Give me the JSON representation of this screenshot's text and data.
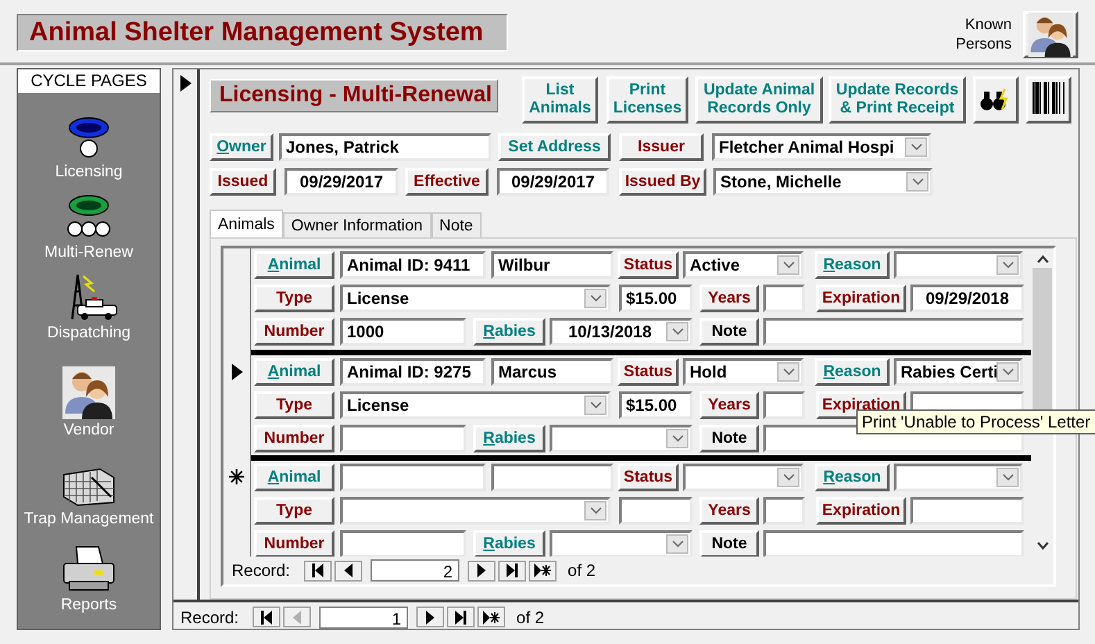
{
  "app_title": "Animal Shelter Management System",
  "known_persons": {
    "label": "Known Persons"
  },
  "sidebar": {
    "header": "CYCLE PAGES",
    "items": [
      {
        "label": "Licensing"
      },
      {
        "label": "Multi-Renew"
      },
      {
        "label": "Dispatching"
      },
      {
        "label": "Vendor"
      },
      {
        "label": "Trap Management"
      },
      {
        "label": "Reports"
      }
    ]
  },
  "form": {
    "title": "Licensing - Multi-Renewal",
    "actions": [
      {
        "text": "List\nAnimals"
      },
      {
        "text": "Print\nLicenses"
      },
      {
        "text": "Update Animal\nRecords Only"
      },
      {
        "text": "Update Records\n& Print Receipt"
      }
    ],
    "owner": {
      "label": "Owner",
      "value": "Jones, Patrick"
    },
    "set_address": "Set Address",
    "issuer": {
      "label": "Issuer",
      "value": "Fletcher Animal Hospi"
    },
    "issued": {
      "label": "Issued",
      "value": "09/29/2017"
    },
    "effective": {
      "label": "Effective",
      "value": "09/29/2017"
    },
    "issued_by": {
      "label": "Issued By",
      "value": "Stone, Michelle"
    }
  },
  "tabs": [
    {
      "label": "Animals",
      "selected": true
    },
    {
      "label": "Owner Information",
      "selected": false
    },
    {
      "label": "Note",
      "selected": false
    }
  ],
  "records": [
    {
      "current": false,
      "new_row": false,
      "labels": {
        "animal": "Animal",
        "status": "Status",
        "reason": "Reason",
        "type": "Type",
        "years": "Years",
        "expiration": "Expiration",
        "number": "Number",
        "rabies": "Rabies",
        "note": "Note"
      },
      "animal_id": "Animal ID: 9411",
      "name": "Wilbur",
      "status": "Active",
      "type": "License",
      "fee": "$15.00",
      "expiration": "09/29/2018",
      "number": "1000",
      "rabies": "10/13/2018"
    },
    {
      "current": true,
      "new_row": false,
      "labels": {
        "animal": "Animal",
        "status": "Status",
        "reason": "Reason",
        "type": "Type",
        "years": "Years",
        "expiration": "Expiration",
        "number": "Number",
        "rabies": "Rabies",
        "note": "Note"
      },
      "animal_id": "Animal ID: 9275",
      "name": "Marcus",
      "status": "Hold",
      "reason": "Rabies Certi",
      "type": "License",
      "fee": "$15.00"
    },
    {
      "current": false,
      "new_row": true,
      "labels": {
        "animal": "Animal",
        "status": "Status",
        "reason": "Reason",
        "type": "Type",
        "years": "Years",
        "expiration": "Expiration",
        "number": "Number",
        "rabies": "Rabies",
        "note": "Note"
      }
    }
  ],
  "tooltip": "Print 'Unable to Process' Letter",
  "sub_nav": {
    "label": "Record:",
    "current": "2",
    "total": "of 2",
    "prev_disabled": false
  },
  "main_nav": {
    "label": "Record:",
    "current": "1",
    "total": "of 2",
    "prev_disabled": true
  }
}
